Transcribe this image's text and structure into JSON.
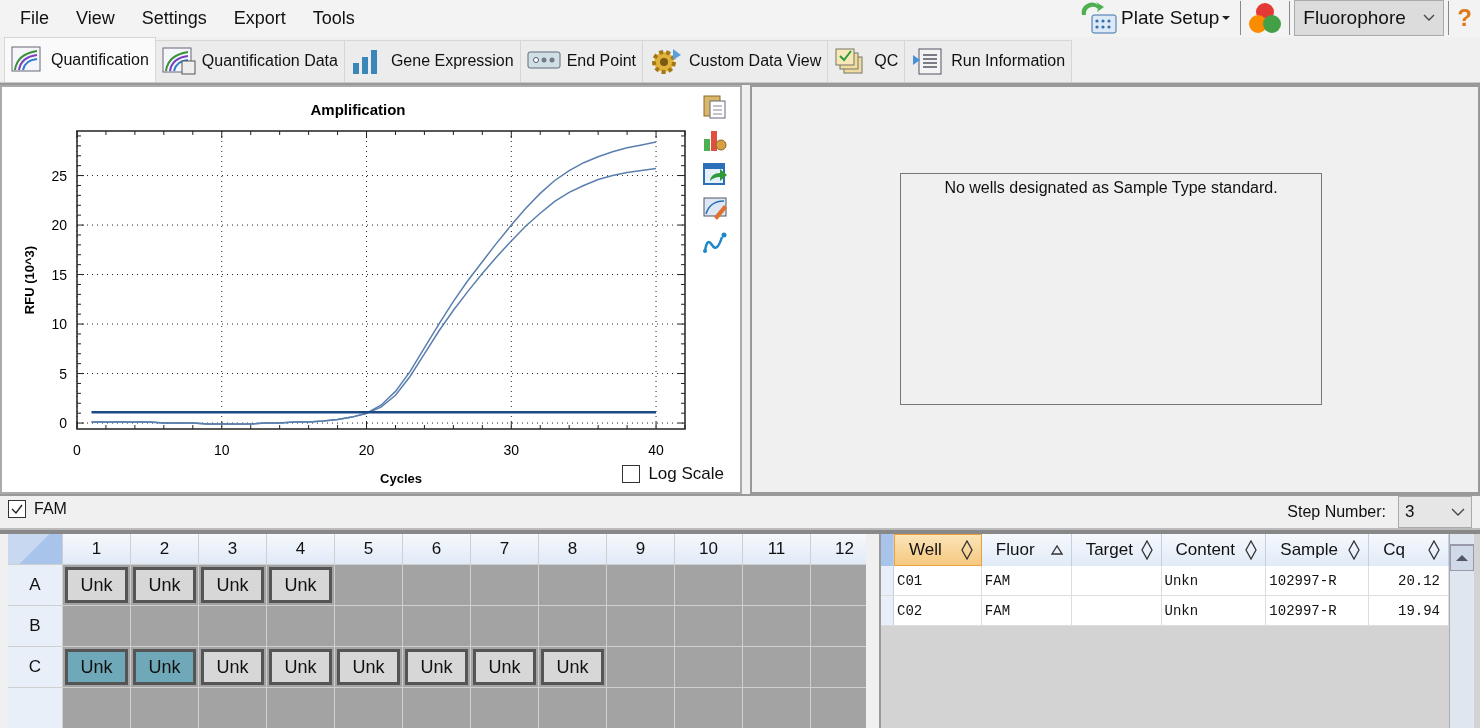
{
  "menu": [
    "File",
    "View",
    "Settings",
    "Export",
    "Tools"
  ],
  "toolbar": {
    "plate_setup": "Plate Setup",
    "fluorophore": "Fluorophore",
    "help": "?"
  },
  "tabs": [
    {
      "label": "Quantification",
      "selected": true
    },
    {
      "label": "Quantification Data",
      "selected": false
    },
    {
      "label": "Gene Expression",
      "selected": false
    },
    {
      "label": "End Point",
      "selected": false
    },
    {
      "label": "Custom Data View",
      "selected": false
    },
    {
      "label": "QC",
      "selected": false
    },
    {
      "label": "Run Information",
      "selected": false
    }
  ],
  "chart": {
    "log_scale": {
      "label": "Log Scale",
      "checked": false
    },
    "chart_data": {
      "type": "line",
      "title": "Amplification",
      "xlabel": "Cycles",
      "ylabel": "RFU (10^3)",
      "x": [
        1,
        2,
        3,
        4,
        5,
        6,
        7,
        8,
        9,
        10,
        11,
        12,
        13,
        14,
        15,
        16,
        17,
        18,
        19,
        20,
        21,
        22,
        23,
        24,
        25,
        26,
        27,
        28,
        29,
        30,
        31,
        32,
        33,
        34,
        35,
        36,
        37,
        38,
        39,
        40
      ],
      "series": [
        {
          "color": "#5a7fae",
          "values": [
            0.1,
            0.1,
            0.1,
            0.1,
            0.1,
            0,
            0,
            0,
            -0.1,
            -0.1,
            -0.1,
            -0.1,
            0,
            0,
            0.1,
            0.1,
            0.2,
            0.35,
            0.6,
            1.0,
            1.8,
            3.2,
            5.2,
            7.6,
            10.0,
            12.3,
            14.4,
            16.3,
            18.2,
            20.0,
            21.7,
            23.2,
            24.5,
            25.5,
            26.3,
            26.9,
            27.4,
            27.8,
            28.1,
            28.4
          ]
        },
        {
          "color": "#5a7fae",
          "values": [
            0.1,
            0.1,
            0.1,
            0.1,
            0.1,
            0,
            0,
            0,
            -0.1,
            -0.1,
            -0.1,
            -0.1,
            0,
            0,
            0.1,
            0.1,
            0.2,
            0.35,
            0.6,
            1.0,
            1.6,
            2.8,
            4.7,
            7.0,
            9.3,
            11.4,
            13.3,
            15.1,
            16.8,
            18.4,
            19.9,
            21.2,
            22.4,
            23.3,
            24.0,
            24.6,
            25.0,
            25.3,
            25.5,
            25.7
          ]
        },
        {
          "color": "#1c4a86",
          "values": [
            1.1,
            1.1,
            1.1,
            1.1,
            1.1,
            1.1,
            1.1,
            1.1,
            1.1,
            1.1,
            1.1,
            1.1,
            1.1,
            1.1,
            1.1,
            1.1,
            1.1,
            1.1,
            1.1,
            1.1,
            1.1,
            1.1,
            1.1,
            1.1,
            1.1,
            1.1,
            1.1,
            1.1,
            1.1,
            1.1,
            1.1,
            1.1,
            1.1,
            1.1,
            1.1,
            1.1,
            1.1,
            1.1,
            1.1,
            1.1
          ]
        }
      ],
      "grid": true,
      "xlim": [
        0,
        42
      ],
      "ylim": [
        -0.6,
        29.5
      ],
      "xticks": [
        0,
        10,
        20,
        30,
        40
      ],
      "yticks": [
        0,
        5,
        10,
        15,
        20,
        25
      ]
    }
  },
  "standard_curve": {
    "message": "No wells designated as Sample Type standard."
  },
  "fluor_filter": {
    "label": "FAM",
    "checked": true
  },
  "step_number": {
    "label": "Step Number:",
    "value": "3"
  },
  "plate": {
    "columns": [
      "1",
      "2",
      "3",
      "4",
      "5",
      "6",
      "7",
      "8",
      "9",
      "10",
      "11",
      "12"
    ],
    "rows": [
      {
        "label": "A",
        "wells": [
          {
            "kind": "sample",
            "text": "Unk",
            "selected": false
          },
          {
            "kind": "sample",
            "text": "Unk",
            "selected": false
          },
          {
            "kind": "sample",
            "text": "Unk",
            "selected": false
          },
          {
            "kind": "sample",
            "text": "Unk",
            "selected": false
          },
          {
            "kind": "empty"
          },
          {
            "kind": "empty"
          },
          {
            "kind": "empty"
          },
          {
            "kind": "empty"
          },
          {
            "kind": "empty"
          },
          {
            "kind": "empty"
          },
          {
            "kind": "empty"
          },
          {
            "kind": "empty"
          }
        ]
      },
      {
        "label": "B",
        "wells": [
          {
            "kind": "empty"
          },
          {
            "kind": "empty"
          },
          {
            "kind": "empty"
          },
          {
            "kind": "empty"
          },
          {
            "kind": "empty"
          },
          {
            "kind": "empty"
          },
          {
            "kind": "empty"
          },
          {
            "kind": "empty"
          },
          {
            "kind": "empty"
          },
          {
            "kind": "empty"
          },
          {
            "kind": "empty"
          },
          {
            "kind": "empty"
          }
        ]
      },
      {
        "label": "C",
        "wells": [
          {
            "kind": "sample",
            "text": "Unk",
            "selected": true
          },
          {
            "kind": "sample",
            "text": "Unk",
            "selected": true
          },
          {
            "kind": "sample",
            "text": "Unk",
            "selected": false
          },
          {
            "kind": "sample",
            "text": "Unk",
            "selected": false
          },
          {
            "kind": "sample",
            "text": "Unk",
            "selected": false
          },
          {
            "kind": "sample",
            "text": "Unk",
            "selected": false
          },
          {
            "kind": "sample",
            "text": "Unk",
            "selected": false
          },
          {
            "kind": "sample",
            "text": "Unk",
            "selected": false
          },
          {
            "kind": "empty"
          },
          {
            "kind": "empty"
          },
          {
            "kind": "empty"
          },
          {
            "kind": "empty"
          }
        ]
      }
    ]
  },
  "table": {
    "columns": [
      {
        "label": "Well",
        "selected": true,
        "sorted_ascending": false
      },
      {
        "label": "Fluor",
        "selected": false,
        "sorted_ascending": true
      },
      {
        "label": "Target",
        "selected": false,
        "sorted_ascending": false
      },
      {
        "label": "Content",
        "selected": false,
        "sorted_ascending": false
      },
      {
        "label": "Sample",
        "selected": false,
        "sorted_ascending": false
      },
      {
        "label": "Cq",
        "selected": false,
        "sorted_ascending": false
      }
    ],
    "rows": [
      {
        "well": "C01",
        "fluor": "FAM",
        "content": "Unkn",
        "sample": "102997-R",
        "cq": "20.12"
      },
      {
        "well": "C02",
        "fluor": "FAM",
        "content": "Unkn",
        "sample": "102997-R",
        "cq": "19.94"
      }
    ]
  }
}
